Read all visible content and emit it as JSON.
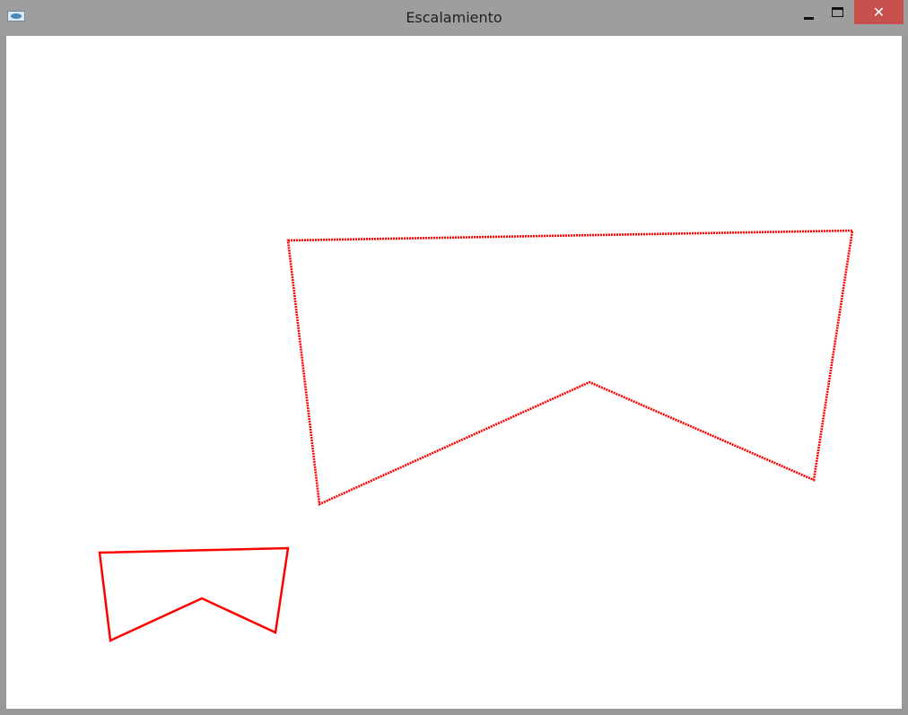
{
  "window": {
    "title": "Escalamiento",
    "close_glyph": "✕",
    "icons": {
      "app": "app-icon",
      "minimize": "minimize-icon",
      "maximize": "maximize-icon",
      "close": "close-icon"
    }
  },
  "colors": {
    "stroke": "#ff0000",
    "titlebar": "#9e9e9e",
    "close_button": "#c7504c",
    "canvas": "#ffffff"
  }
}
